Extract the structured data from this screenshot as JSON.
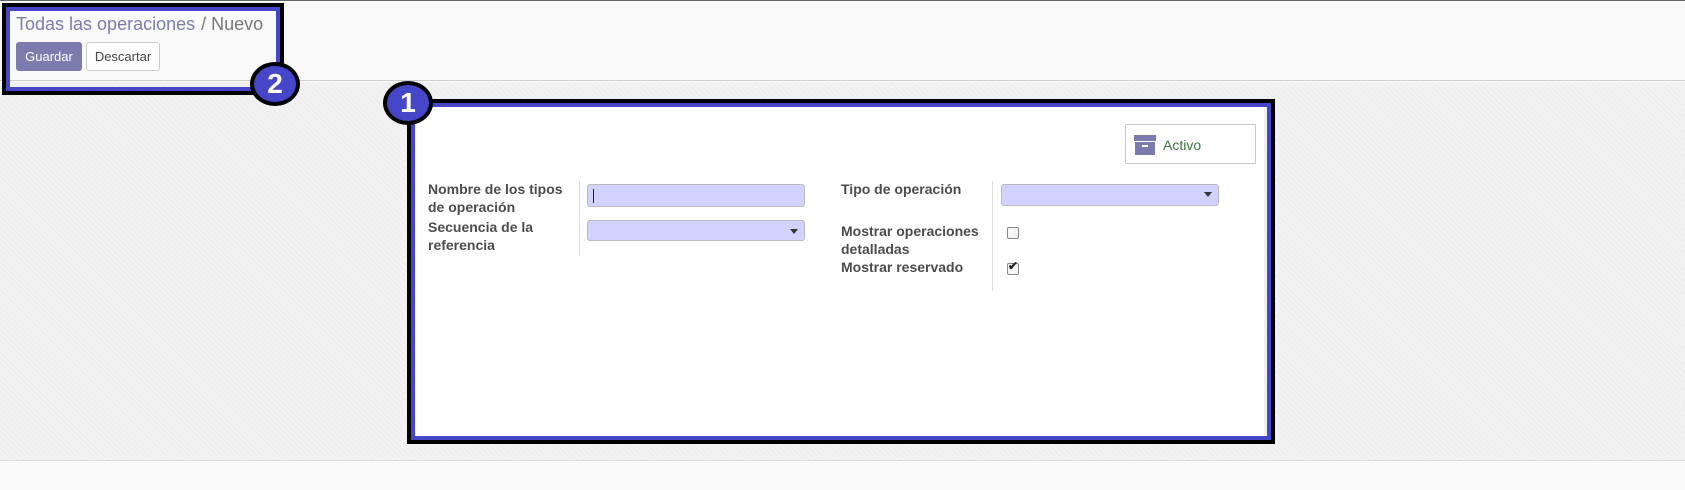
{
  "breadcrumb": {
    "parent": "Todas las operaciones",
    "separator": "/",
    "current": "Nuevo"
  },
  "buttons": {
    "save": "Guardar",
    "discard": "Descartar"
  },
  "callouts": {
    "form": "1",
    "control_panel": "2"
  },
  "smart_button": {
    "label": "Activo",
    "icon": "archive-icon"
  },
  "fields": {
    "name_label": "Nombre de los tipos de operación",
    "name_value": "",
    "sequence_label": "Secuencia de la referencia",
    "sequence_value": "",
    "type_label": "Tipo de operación",
    "type_value": "",
    "show_detailed_label": "Mostrar operaciones detalladas",
    "show_detailed_checked": false,
    "show_reserved_label": "Mostrar reservado",
    "show_reserved_checked": true
  },
  "colors": {
    "primary": "#7c7bad",
    "callout": "#4646c8",
    "required_field": "#d2d2ff",
    "active_text": "#3c763d"
  }
}
